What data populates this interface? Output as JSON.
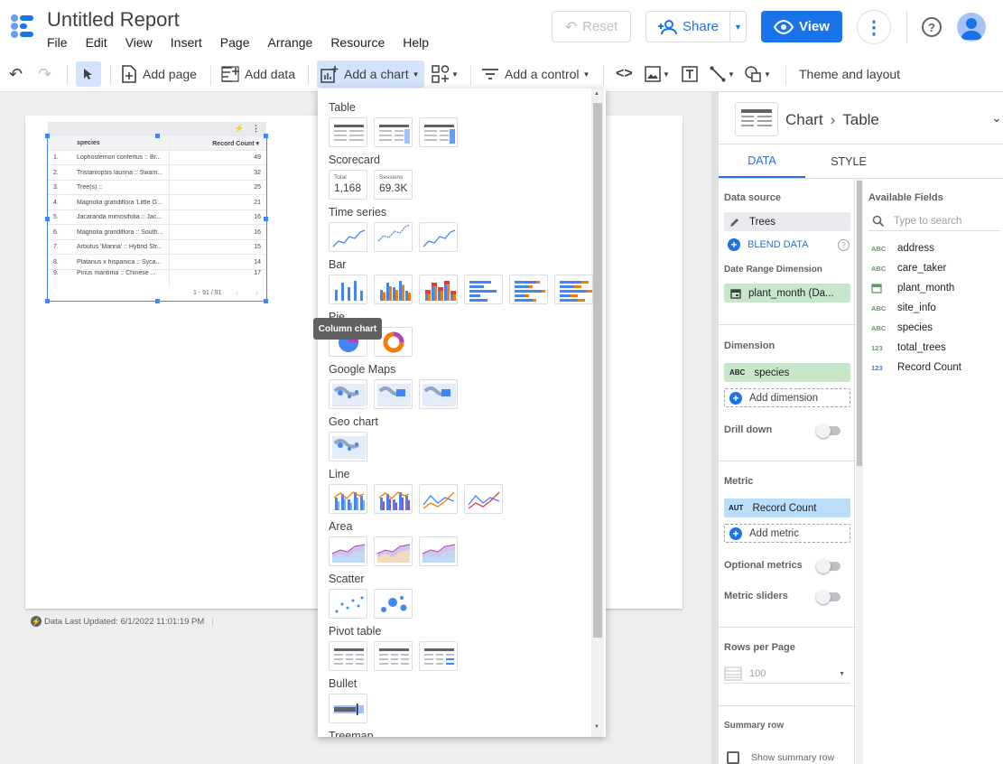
{
  "app": {
    "title": "Untitled Report"
  },
  "menu": [
    "File",
    "Edit",
    "View",
    "Insert",
    "Page",
    "Arrange",
    "Resource",
    "Help"
  ],
  "header_buttons": {
    "reset": "Reset",
    "share": "Share",
    "view": "View"
  },
  "toolbar": {
    "add_page": "Add page",
    "add_data": "Add data",
    "add_chart": "Add a chart",
    "add_control": "Add a control",
    "theme": "Theme and layout"
  },
  "table_widget": {
    "headers": [
      "species",
      "Record Count"
    ],
    "rows": [
      {
        "n": "1.",
        "species": "Lophostemon confertus :: Br...",
        "count": "49"
      },
      {
        "n": "2.",
        "species": "Tristaniopsis laurina :: Swam...",
        "count": "32"
      },
      {
        "n": "3.",
        "species": "Tree(s) ::",
        "count": "25"
      },
      {
        "n": "4.",
        "species": "Magnolia grandiflora 'Little G...",
        "count": "21"
      },
      {
        "n": "5.",
        "species": "Jacaranda mimosifolia :: Jac...",
        "count": "16"
      },
      {
        "n": "6.",
        "species": "Magnolia grandiflora :: South...",
        "count": "16"
      },
      {
        "n": "7.",
        "species": "Arbutus 'Marina' :: Hybrid Str...",
        "count": "15"
      },
      {
        "n": "8.",
        "species": "Platanus x hispanica :: Syca...",
        "count": "14"
      },
      {
        "n": "9.",
        "species": "Pinus maritima :: Chinese ...",
        "count": "17"
      }
    ],
    "pagination": "1 - 91 / 91"
  },
  "status": "Data Last Updated: 6/1/2022 11:01:19 PM",
  "chart_menu": {
    "sections": [
      "Table",
      "Scorecard",
      "Time series",
      "Bar",
      "Pie",
      "Google Maps",
      "Geo chart",
      "Line",
      "Area",
      "Scatter",
      "Pivot table",
      "Bullet",
      "Treemap"
    ],
    "scorecards": [
      {
        "label": "Total",
        "value": "1,168"
      },
      {
        "label": "Sessions",
        "value": "69.3K"
      }
    ],
    "tooltip": "Column chart"
  },
  "panel": {
    "crumb_a": "Chart",
    "crumb_b": "Table",
    "tabs": [
      "DATA",
      "STYLE"
    ],
    "data_source_label": "Data source",
    "data_source": "Trees",
    "blend": "BLEND DATA",
    "date_range_label": "Date Range Dimension",
    "date_range": "plant_month (Da...",
    "dimension_label": "Dimension",
    "dimension": "species",
    "dimension_type": "ABC",
    "add_dimension": "Add dimension",
    "drill_down": "Drill down",
    "metric_label": "Metric",
    "metric": "Record Count",
    "metric_type": "AUT",
    "add_metric": "Add metric",
    "optional_metrics": "Optional metrics",
    "metric_sliders": "Metric sliders",
    "rows_per_page_label": "Rows per Page",
    "rows_per_page": "100",
    "summary_row_label": "Summary row",
    "show_summary": "Show summary row",
    "available_label": "Available Fields",
    "search_placeholder": "Type to search",
    "fields": [
      {
        "type": "ABC",
        "name": "address",
        "color": "#5f9e5f"
      },
      {
        "type": "ABC",
        "name": "care_taker",
        "color": "#5f9e5f"
      },
      {
        "type": "CAL",
        "name": "plant_month",
        "color": "#5f9e5f"
      },
      {
        "type": "ABC",
        "name": "site_info",
        "color": "#5f9e5f"
      },
      {
        "type": "ABC",
        "name": "species",
        "color": "#5f9e5f"
      },
      {
        "type": "123",
        "name": "total_trees",
        "color": "#5f9e5f"
      },
      {
        "type": "123",
        "name": "Record Count",
        "color": "#4a7fd4"
      }
    ]
  },
  "colors": {
    "accent": "#1a73e8",
    "dim_chip": "#c8e6c9",
    "metric_chip": "#bbdefb"
  }
}
